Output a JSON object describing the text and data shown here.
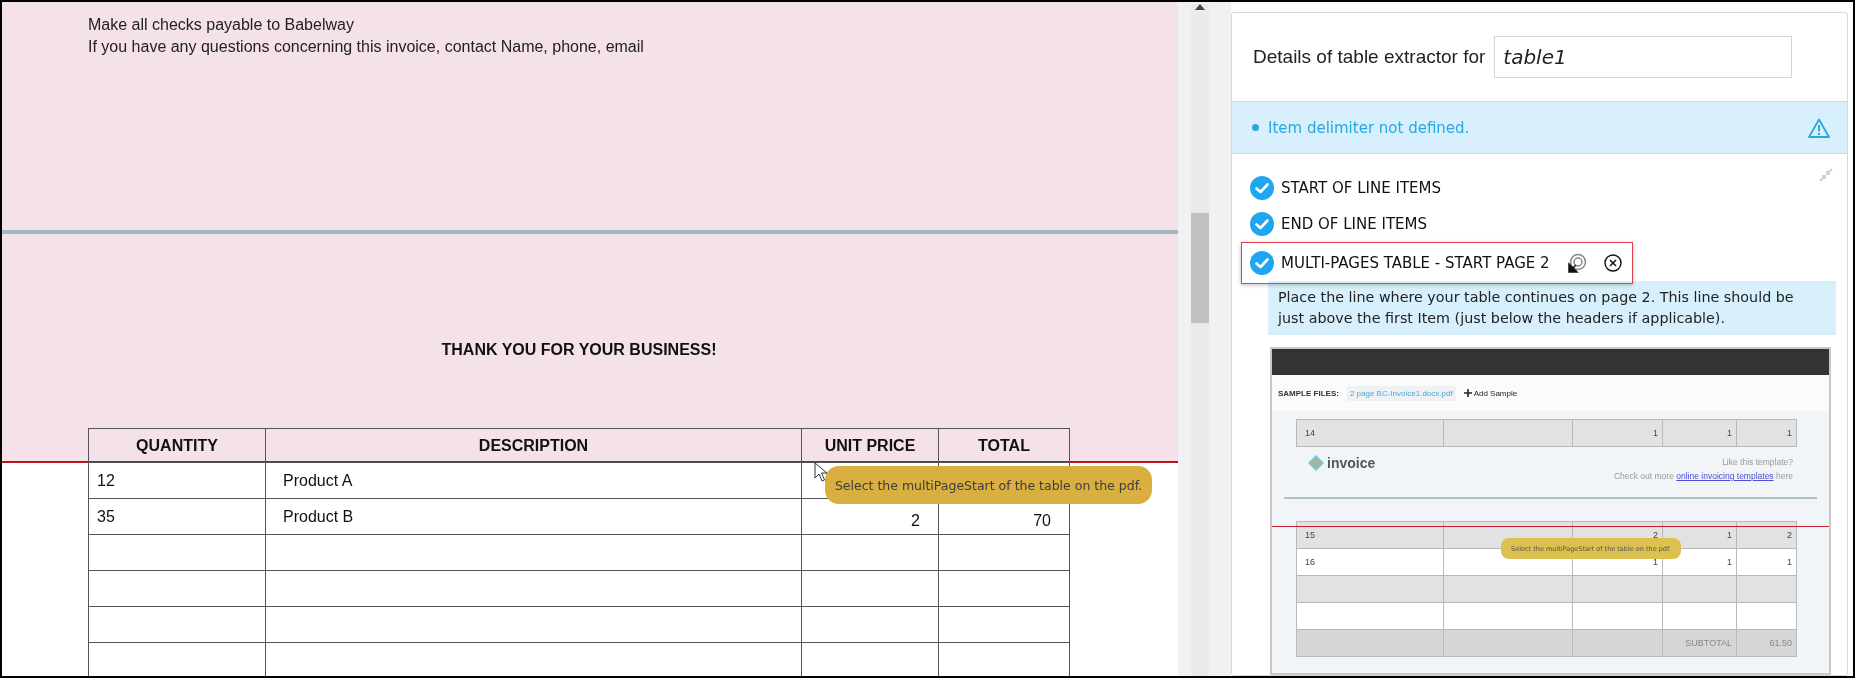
{
  "document": {
    "lines": [
      "Make all checks payable to Babelway",
      "If you have any questions concerning this invoice, contact Name, phone, email"
    ],
    "thank_you": "THANK YOU FOR YOUR BUSINESS!",
    "table": {
      "columns": [
        "QUANTITY",
        "DESCRIPTION",
        "UNIT PRICE",
        "TOTAL"
      ],
      "rows": [
        {
          "quantity": "12",
          "description": "Product A"
        },
        {
          "quantity": "35",
          "description": "Product B",
          "unit_price": "2",
          "total": "70"
        },
        {},
        {},
        {},
        {}
      ]
    }
  },
  "tooltip": "Select the multiPageStart of the table on the pdf.",
  "panel": {
    "title": "Details of table extractor for",
    "table_name": "table1",
    "alerts": [
      {
        "text": "Item delimiter not defined."
      }
    ],
    "steps": [
      {
        "label": "START OF LINE ITEMS",
        "checked": true,
        "selected": false
      },
      {
        "label": "END OF LINE ITEMS",
        "checked": true,
        "selected": false
      },
      {
        "label": "MULTI-PAGES TABLE - START PAGE 2",
        "checked": true,
        "selected": true
      }
    ],
    "hint": "Place the line where your table continues on page 2. This line should be just above the first Item (just below the headers if applicable).",
    "sample": {
      "files_label": "SAMPLE FILES:",
      "file": "2 page BC-Invoice1.docx.pdf",
      "add": "Add Sample",
      "rows_top": [
        {
          "col_1": "14",
          "col_3": "1",
          "col_4": "1",
          "col_5": "1"
        }
      ],
      "logo": "invoice",
      "like": "Like this template?",
      "check_prefix": "Check out more",
      "link": "online invoicing templates",
      "check_suffix": "here",
      "rows": [
        {
          "col_1": "15",
          "col_3": "2",
          "col_4": "1",
          "col_5": "2"
        },
        {
          "col_1": "16",
          "col_3": "1",
          "col_4": "1",
          "col_5": "1"
        },
        {},
        {},
        {
          "kind": "subtotal",
          "col_4": "SUBTOTAL",
          "col_5": "61.50"
        }
      ],
      "tooltip": "Select the multiPageStart of the table on the pdf."
    }
  }
}
